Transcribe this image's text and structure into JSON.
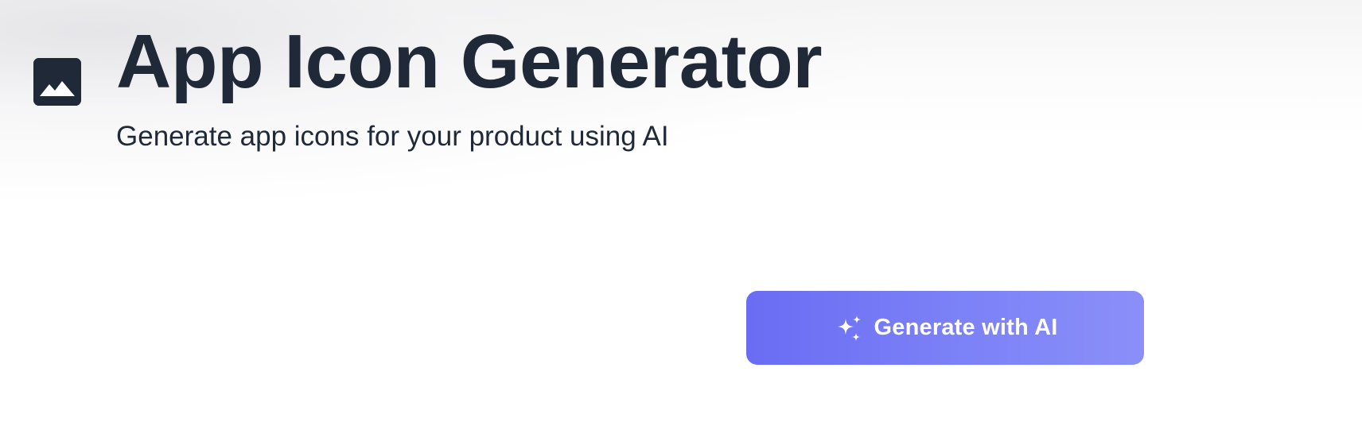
{
  "header": {
    "icon": "image-icon",
    "title": "App Icon Generator",
    "subtitle": "Generate app icons for your product using AI"
  },
  "actions": {
    "generate_icon": "sparkles-icon",
    "generate_label": "Generate with AI"
  },
  "colors": {
    "text_primary": "#1f2937",
    "icon_bg": "#1f2937",
    "button_gradient_start": "#6a6cf3",
    "button_gradient_end": "#8a8ff9",
    "button_text": "#ffffff"
  }
}
